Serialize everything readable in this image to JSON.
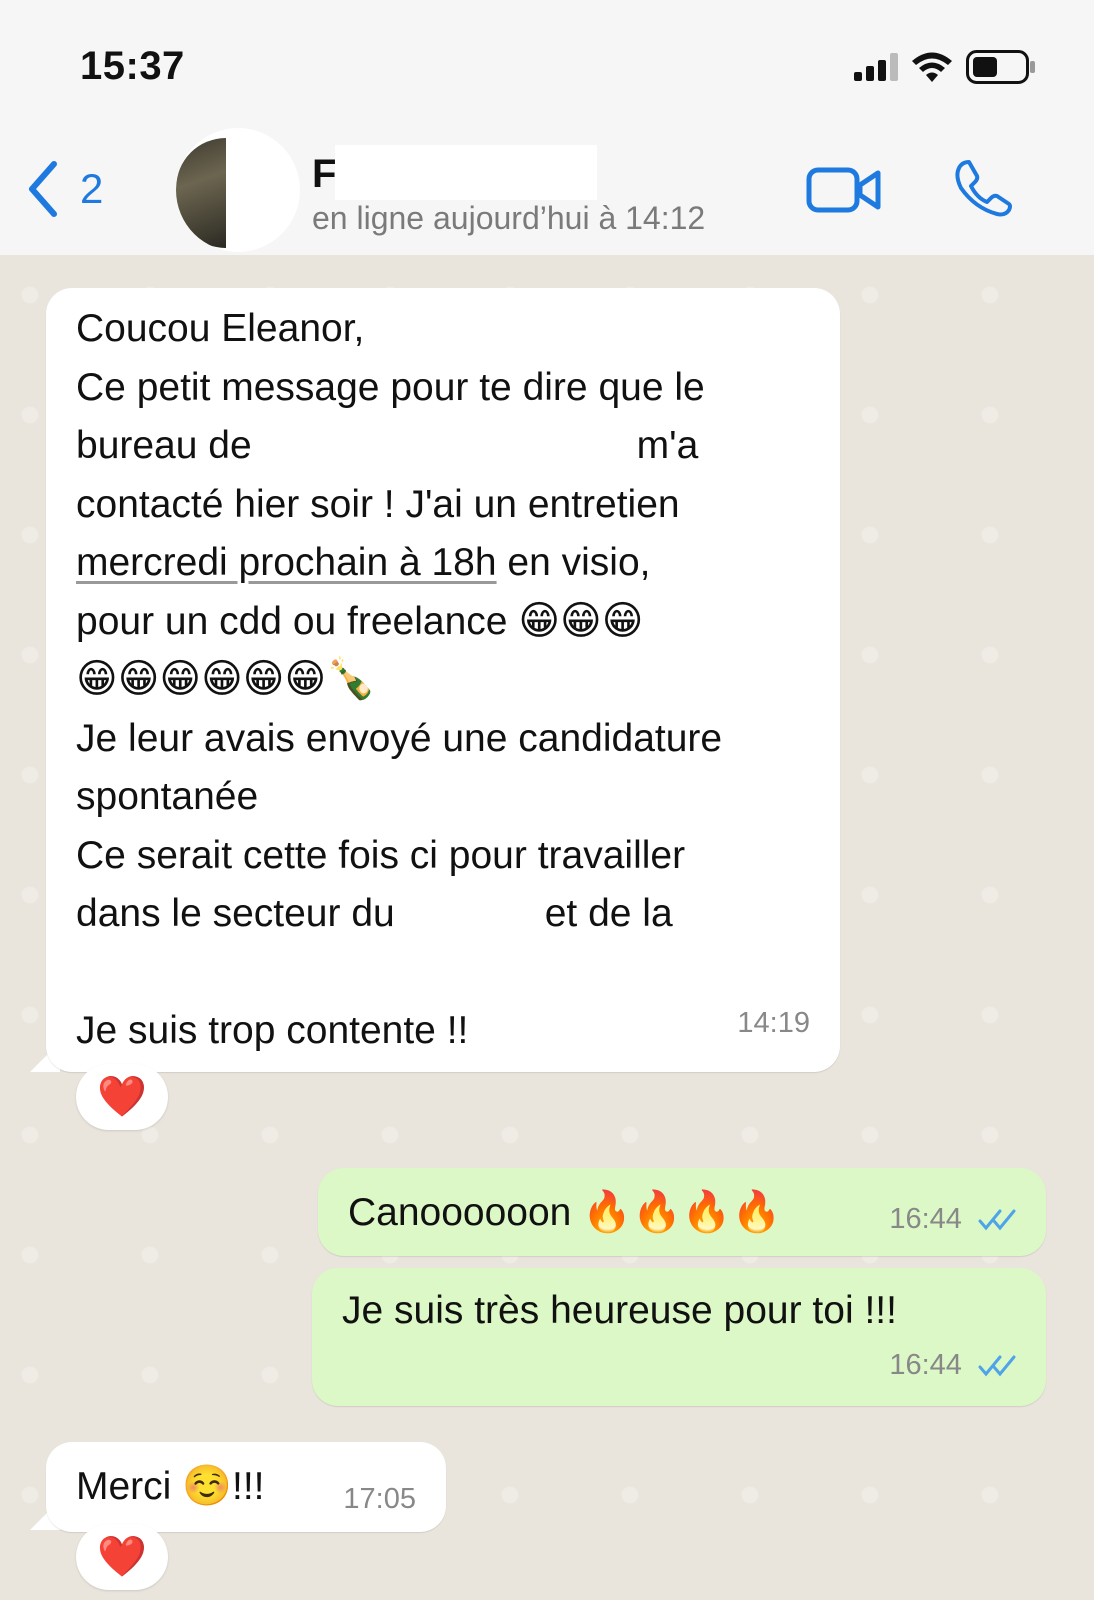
{
  "status_bar": {
    "time": "15:37"
  },
  "header": {
    "back_count": "2",
    "contact_initial": "F",
    "contact_status": "en ligne aujourd’hui à 14:12"
  },
  "messages": [
    {
      "direction": "incoming",
      "lines": [
        "Coucou Eleanor,",
        "Ce petit message pour te dire que le",
        "bureau de",
        "m'a",
        "contacté hier soir ! J'ai un entretien",
        "mercredi prochain à 18h",
        " en visio,",
        "pour un cdd ou freelance",
        "Je leur avais envoyé une candidature",
        "spontanée",
        "Ce serait cette fois ci pour travailler",
        "dans le secteur du",
        "et de la",
        "Je suis trop contente !!"
      ],
      "emoji_row1": "😁😁😁",
      "emoji_row2": "😁😁😁😁😁😁🍾",
      "time": "14:19",
      "reaction": "❤️"
    },
    {
      "direction": "outgoing",
      "text": "Canoooooon",
      "emoji": "🔥🔥🔥🔥",
      "time": "16:44",
      "read": true
    },
    {
      "direction": "outgoing",
      "text": "Je suis très heureuse pour toi !!!",
      "time": "16:44",
      "read": true
    },
    {
      "direction": "incoming",
      "text": "Merci",
      "emoji": "☺️",
      "suffix": "!!!",
      "time": "17:05",
      "reaction": "❤️"
    }
  ],
  "colors": {
    "accent": "#1f7ae0",
    "outgoing_bubble": "#dcf8c6",
    "incoming_bubble": "#ffffff",
    "chat_bg": "#e9e4dc",
    "read_ticks": "#4fa3e8"
  },
  "icons": [
    "back-chevron-icon",
    "video-call-icon",
    "phone-icon",
    "signal-icon",
    "wifi-icon",
    "battery-icon"
  ]
}
